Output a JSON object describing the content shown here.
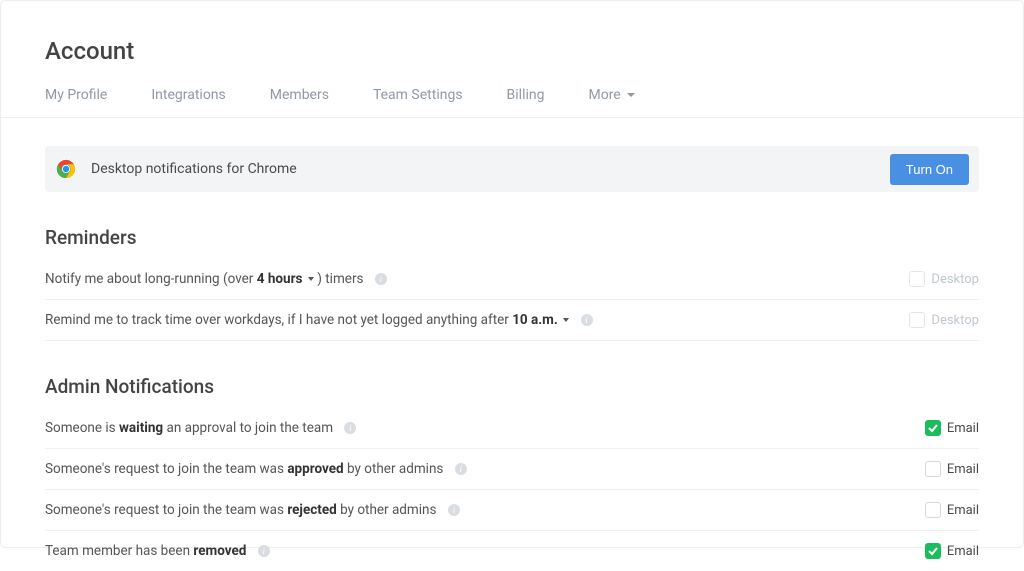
{
  "header": {
    "title": "Account",
    "tabs": {
      "profile": "My Profile",
      "integrations": "Integrations",
      "members": "Members",
      "team_settings": "Team Settings",
      "billing": "Billing",
      "more": "More"
    }
  },
  "banner": {
    "text": "Desktop notifications for Chrome",
    "button": "Turn On"
  },
  "reminders": {
    "title": "Reminders",
    "long_running_prefix": "Notify me about long-running (over ",
    "long_running_value": "4 hours",
    "long_running_suffix": " ) timers",
    "workdays_prefix": "Remind me to track time over workdays, if I have not yet logged anything after ",
    "workdays_value": "10 a.m.",
    "check_label_desktop": "Desktop",
    "check1": false,
    "check2": false
  },
  "admin": {
    "title": "Admin Notifications",
    "row1_a": "Someone is ",
    "row1_b": "waiting",
    "row1_c": " an approval to join the team",
    "row2_a": "Someone's request to join the team was ",
    "row2_b": "approved",
    "row2_c": " by other admins",
    "row3_a": "Someone's request to join the team was ",
    "row3_b": "rejected",
    "row3_c": " by other admins",
    "row4_a": "Team member has been ",
    "row4_b": "removed",
    "check_label_email": "Email",
    "check1": true,
    "check2": false,
    "check3": false,
    "check4": true
  }
}
